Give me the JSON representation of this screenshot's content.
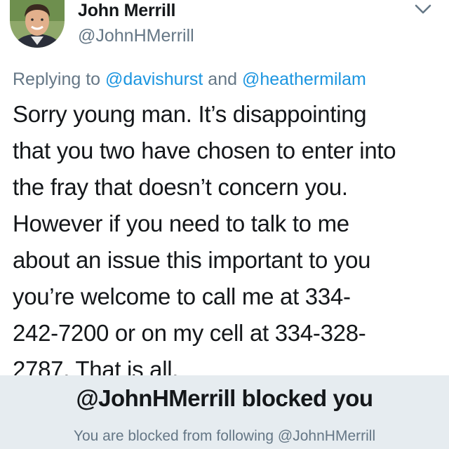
{
  "user": {
    "display_name": "John Merrill",
    "handle": "@JohnHMerrill"
  },
  "reply": {
    "prefix": "Replying to ",
    "mention_1": "@davishurst",
    "conjunction": " and ",
    "mention_2": "@heathermilam"
  },
  "tweet": {
    "lines": [
      "Sorry young man. It’s disappointing",
      "that you two have chosen to enter into",
      "the fray that doesn’t concern you.",
      "However if you need to talk to me",
      "about an issue this important to you",
      "you’re welcome to call me at 334-",
      "242-7200 or on my cell at 334-328-",
      "2787. That is all."
    ]
  },
  "block_banner": {
    "title": "@JohnHMerrill blocked you",
    "subtitle": "You are blocked from following @JohnHMerrill"
  },
  "icons": {
    "menu": "chevron-down-icon",
    "profile": "avatar"
  },
  "colors": {
    "link": "#1b95e0",
    "secondary_text": "#657786",
    "banner_bg": "#e6ecf0"
  }
}
